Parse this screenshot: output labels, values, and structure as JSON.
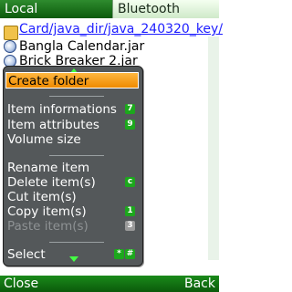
{
  "tabs": {
    "local": "Local",
    "bluetooth": "Bluetooth"
  },
  "file_list": {
    "path": "Card/java_dir/java_240320_key/",
    "files": [
      "Bangla Calendar.jar",
      "Brick Breaker 2.jar"
    ]
  },
  "context_menu": {
    "items": [
      {
        "label": "Create folder",
        "key": ""
      },
      {
        "label": "Item informations",
        "key": "7"
      },
      {
        "label": "Item attributes",
        "key": "9"
      },
      {
        "label": "Volume size",
        "key": ""
      },
      {
        "label": "Rename item",
        "key": ""
      },
      {
        "label": "Delete item(s)",
        "key": "c"
      },
      {
        "label": "Cut item(s)",
        "key": ""
      },
      {
        "label": "Copy item(s)",
        "key": "1"
      },
      {
        "label": "Paste item(s)",
        "key": "3"
      },
      {
        "label": "Select",
        "key": "*",
        "key2": "#"
      }
    ]
  },
  "softkeys": {
    "left": "Close",
    "right": "Back"
  },
  "colors": {
    "accent": "#0c5a0c",
    "selection": "#ee8a00",
    "menu_bg": "#54585a"
  }
}
